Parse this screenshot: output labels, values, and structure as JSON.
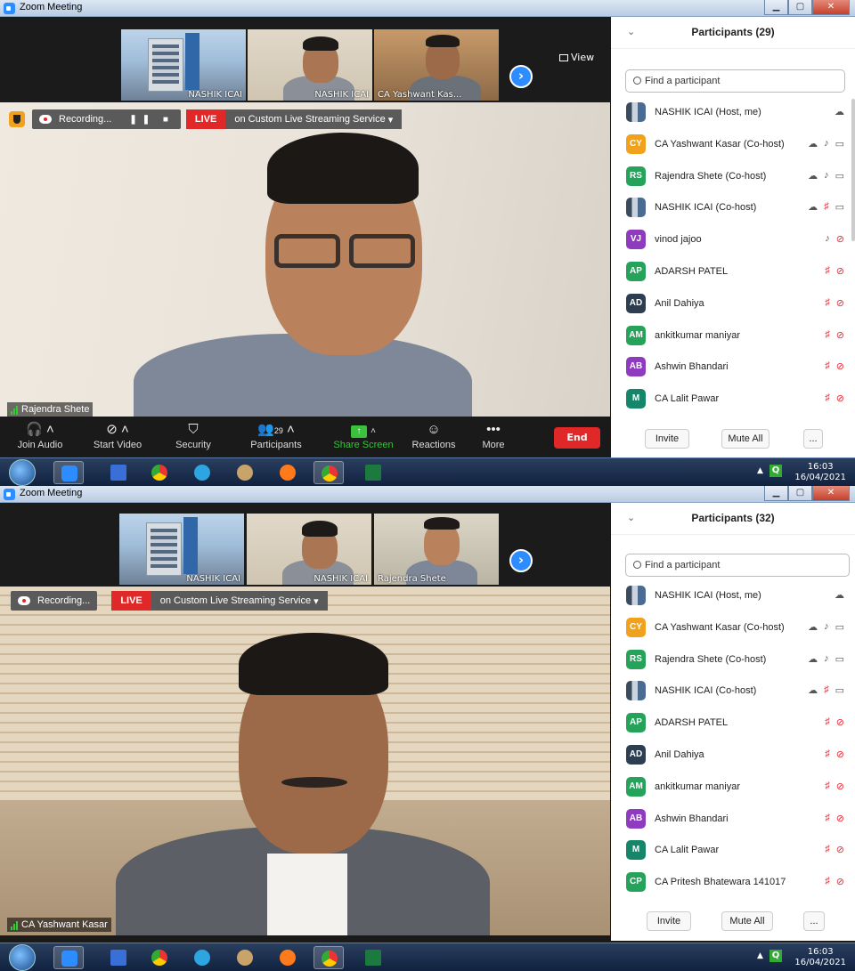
{
  "screen1": {
    "window_title": "Zoom Meeting",
    "thumbnails": [
      "NASHIK ICAI",
      "NASHIK ICAI",
      "CA Yashwant Kas..."
    ],
    "view_label": "View",
    "recording_label": "Recording...",
    "live_label": "LIVE",
    "stream_label": "on Custom Live Streaming Service",
    "active_speaker": "Rajendra Shete",
    "controls": {
      "join_audio": "Join Audio",
      "start_video": "Start Video",
      "security": "Security",
      "participants": "Participants",
      "participant_count": "29",
      "share_screen": "Share Screen",
      "reactions": "Reactions",
      "more": "More",
      "end": "End"
    },
    "panel": {
      "title": "Participants (29)",
      "search_placeholder": "Find a participant",
      "participants": [
        {
          "initials": "",
          "name": "NASHIK ICAI (Host, me)",
          "avatar_color": "image"
        },
        {
          "initials": "CY",
          "name": "CA Yashwant Kasar (Co-host)",
          "avatar_color": "#f0a21c"
        },
        {
          "initials": "RS",
          "name": "Rajendra Shete (Co-host)",
          "avatar_color": "#25a35a"
        },
        {
          "initials": "",
          "name": "NASHIK ICAI (Co-host)",
          "avatar_color": "image"
        },
        {
          "initials": "VJ",
          "name": "vinod jajoo",
          "avatar_color": "#8e3bbf"
        },
        {
          "initials": "AP",
          "name": "ADARSH PATEL",
          "avatar_color": "#25a35a"
        },
        {
          "initials": "AD",
          "name": "Anil Dahiya",
          "avatar_color": "#2c3e50"
        },
        {
          "initials": "AM",
          "name": "ankitkumar maniyar",
          "avatar_color": "#25a35a"
        },
        {
          "initials": "AB",
          "name": "Ashwin Bhandari",
          "avatar_color": "#8e3bbf"
        },
        {
          "initials": "M",
          "name": "CA Lalit Pawar",
          "avatar_color": "#16866b"
        }
      ],
      "invite": "Invite",
      "mute_all": "Mute All",
      "more": "..."
    },
    "clock_time": "16:03",
    "clock_date": "16/04/2021"
  },
  "screen2": {
    "window_title": "Zoom Meeting",
    "thumbnails": [
      "NASHIK ICAI",
      "NASHIK ICAI",
      "Rajendra Shete"
    ],
    "recording_label": "Recording...",
    "live_label": "LIVE",
    "stream_label": "on Custom Live Streaming Service",
    "active_speaker": "CA Yashwant Kasar",
    "panel": {
      "title": "Participants (32)",
      "search_placeholder": "Find a participant",
      "participants": [
        {
          "initials": "",
          "name": "NASHIK ICAI (Host, me)",
          "avatar_color": "image"
        },
        {
          "initials": "CY",
          "name": "CA Yashwant Kasar (Co-host)",
          "avatar_color": "#f0a21c"
        },
        {
          "initials": "RS",
          "name": "Rajendra Shete (Co-host)",
          "avatar_color": "#25a35a"
        },
        {
          "initials": "",
          "name": "NASHIK ICAI (Co-host)",
          "avatar_color": "image"
        },
        {
          "initials": "AP",
          "name": "ADARSH PATEL",
          "avatar_color": "#25a35a"
        },
        {
          "initials": "AD",
          "name": "Anil Dahiya",
          "avatar_color": "#2c3e50"
        },
        {
          "initials": "AM",
          "name": "ankitkumar maniyar",
          "avatar_color": "#25a35a"
        },
        {
          "initials": "AB",
          "name": "Ashwin Bhandari",
          "avatar_color": "#8e3bbf"
        },
        {
          "initials": "M",
          "name": "CA Lalit Pawar",
          "avatar_color": "#16866b"
        },
        {
          "initials": "CP",
          "name": "CA Pritesh Bhatewara 141017",
          "avatar_color": "#25a35a"
        }
      ],
      "invite": "Invite",
      "mute_all": "Mute All",
      "more": "..."
    },
    "clock_time": "16:03",
    "clock_date": "16/04/2021"
  }
}
